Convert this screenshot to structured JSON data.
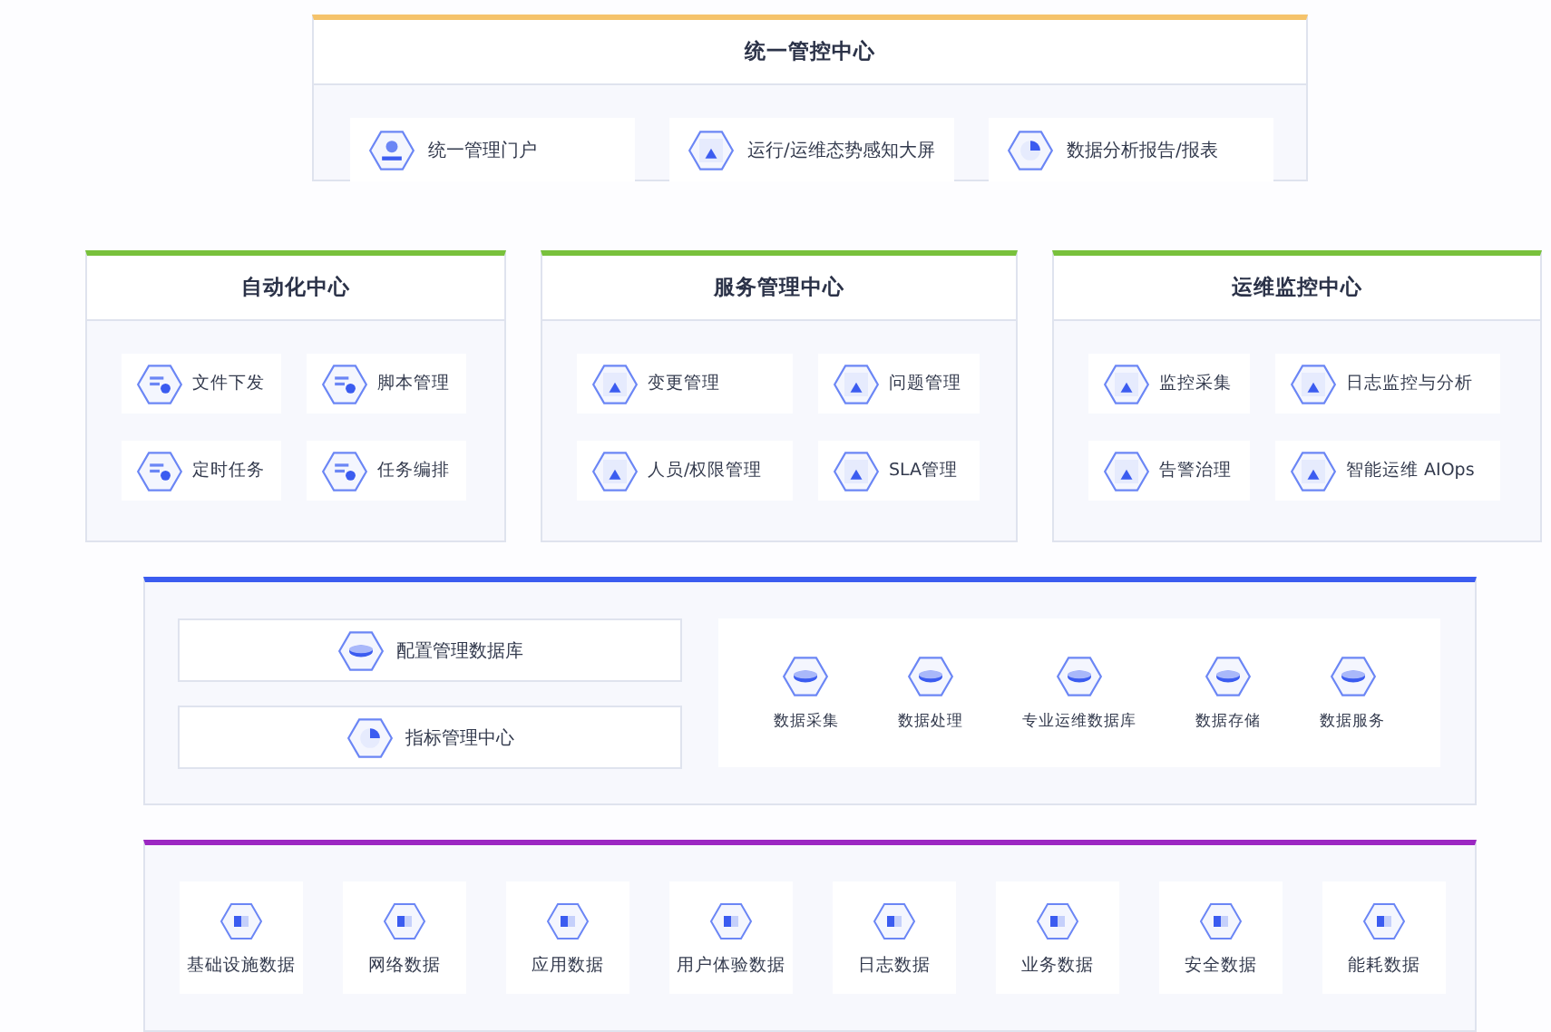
{
  "unified_center": {
    "title": "统一管控中心",
    "items": [
      "统一管理门户",
      "运行/运维态势感知大屏",
      "数据分析报告/报表"
    ]
  },
  "centers": [
    {
      "title": "自动化中心",
      "items": [
        "文件下发",
        "脚本管理",
        "定时任务",
        "任务编排"
      ]
    },
    {
      "title": "服务管理中心",
      "items": [
        "变更管理",
        "问题管理",
        "人员/权限管理",
        "SLA管理"
      ]
    },
    {
      "title": "运维监控中心",
      "items": [
        "监控采集",
        "日志监控与分析",
        "告警治理",
        "智能运维 AIOps"
      ]
    }
  ],
  "data_layer": {
    "left_items": [
      "配置管理数据库",
      "指标管理中心"
    ],
    "right_items": [
      "数据采集",
      "数据处理",
      "专业运维数据库",
      "数据存储",
      "数据服务"
    ]
  },
  "source_layer": {
    "items": [
      "基础设施数据",
      "网络数据",
      "应用数据",
      "用户体验数据",
      "日志数据",
      "业务数据",
      "安全数据",
      "能耗数据"
    ]
  }
}
